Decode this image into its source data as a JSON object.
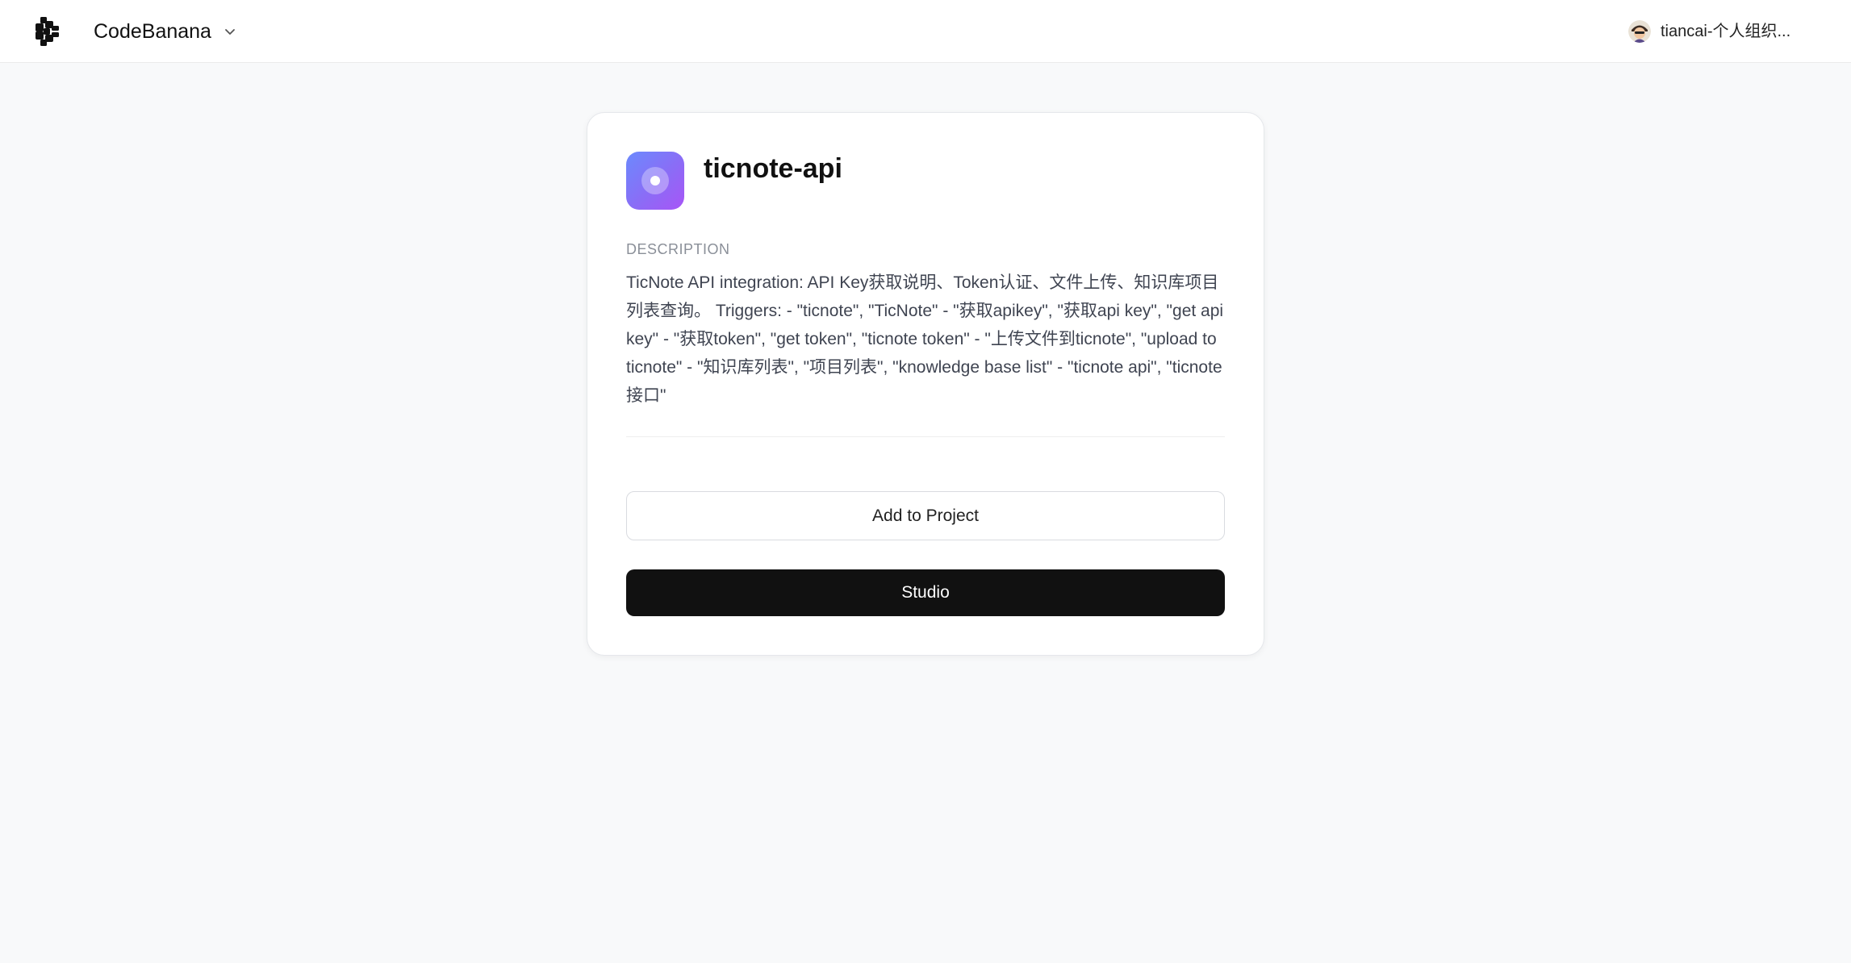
{
  "header": {
    "logo_icon": "codebanana-logo-icon",
    "brand": "CodeBanana",
    "brand_dropdown_icon": "chevron-down-icon",
    "user": {
      "avatar_icon": "user-avatar",
      "name": "tiancai-个人组织..."
    }
  },
  "skill": {
    "icon": "app-target-icon",
    "icon_gradient": [
      "#6b8afd",
      "#a855f7"
    ],
    "title": "ticnote-api",
    "description_label": "DESCRIPTION",
    "description": "TicNote API integration: API Key获取说明、Token认证、文件上传、知识库项目列表查询。 Triggers: - \"ticnote\", \"TicNote\" - \"获取apikey\", \"获取api key\", \"get api key\" - \"获取token\", \"get token\", \"ticnote token\" - \"上传文件到ticnote\", \"upload to ticnote\" - \"知识库列表\", \"项目列表\", \"knowledge base list\" - \"ticnote api\", \"ticnote接口\""
  },
  "actions": {
    "add_to_project": "Add to Project",
    "studio": "Studio"
  },
  "colors": {
    "page_background": "#f8f9fa",
    "primary_button": "#111111",
    "label_gray": "#8a8f98"
  }
}
